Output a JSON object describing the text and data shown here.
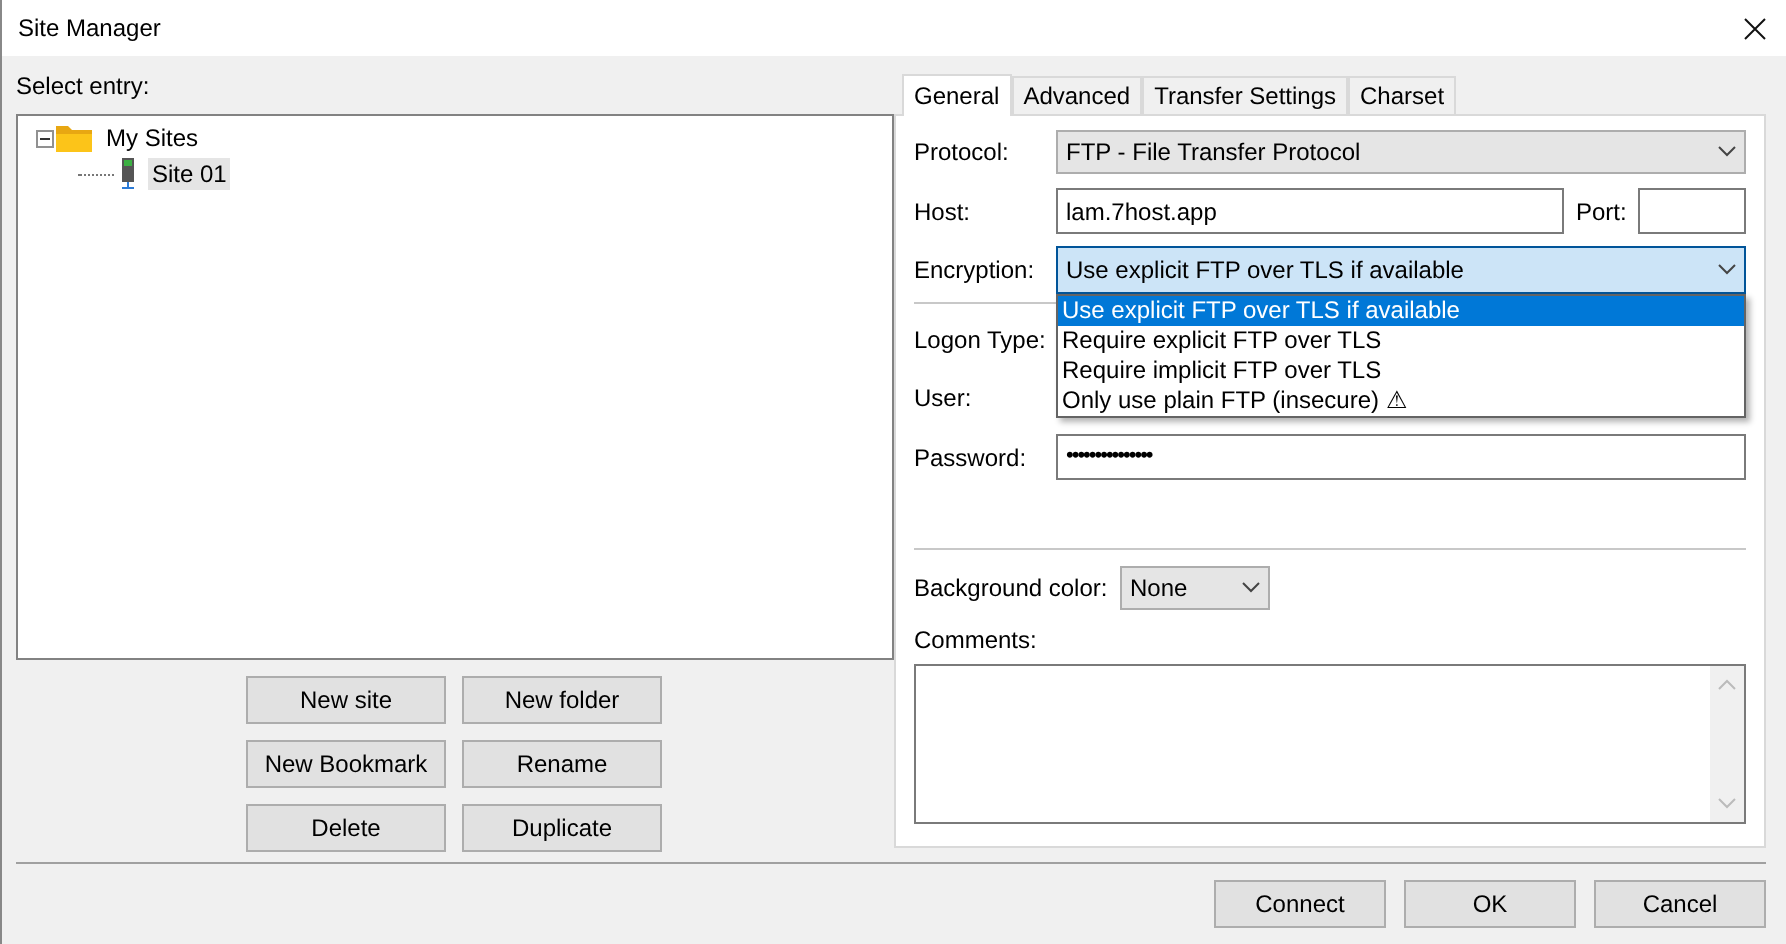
{
  "window": {
    "title": "Site Manager"
  },
  "select_entry_label": "Select entry:",
  "tree": [
    {
      "label": "My Sites",
      "kind": "folder",
      "expanded": true,
      "selected": false,
      "children": [
        {
          "label": "Site 01",
          "kind": "site",
          "selected": true
        }
      ]
    }
  ],
  "site_buttons": [
    "New site",
    "New folder",
    "New Bookmark",
    "Rename",
    "Delete",
    "Duplicate"
  ],
  "tabs": [
    {
      "label": "General",
      "selected": true
    },
    {
      "label": "Advanced",
      "selected": false
    },
    {
      "label": "Transfer Settings",
      "selected": false
    },
    {
      "label": "Charset",
      "selected": false
    }
  ],
  "general": {
    "protocol": {
      "label": "Protocol:",
      "value": "FTP - File Transfer Protocol"
    },
    "host": {
      "label": "Host:",
      "value": "lam.7host.app"
    },
    "port": {
      "label": "Port:"
    },
    "encryption": {
      "label": "Encryption:",
      "value": "Use explicit FTP over TLS if available",
      "expanded": true,
      "options": [
        {
          "label": "Use explicit FTP over TLS if available",
          "selected": true
        },
        {
          "label": "Require explicit FTP over TLS",
          "selected": false
        },
        {
          "label": "Require implicit FTP over TLS",
          "selected": false
        },
        {
          "label": "Only use plain FTP (insecure) ⚠",
          "selected": false
        }
      ]
    },
    "logon_type": {
      "label": "Logon Type:"
    },
    "user": {
      "label": "User:"
    },
    "password": {
      "label": "Password:",
      "value": "•••••••••••••••"
    },
    "background_color": {
      "label": "Background color:",
      "value": "None"
    },
    "comments": {
      "label": "Comments:"
    }
  },
  "dialog_buttons": [
    "Connect",
    "OK",
    "Cancel"
  ]
}
